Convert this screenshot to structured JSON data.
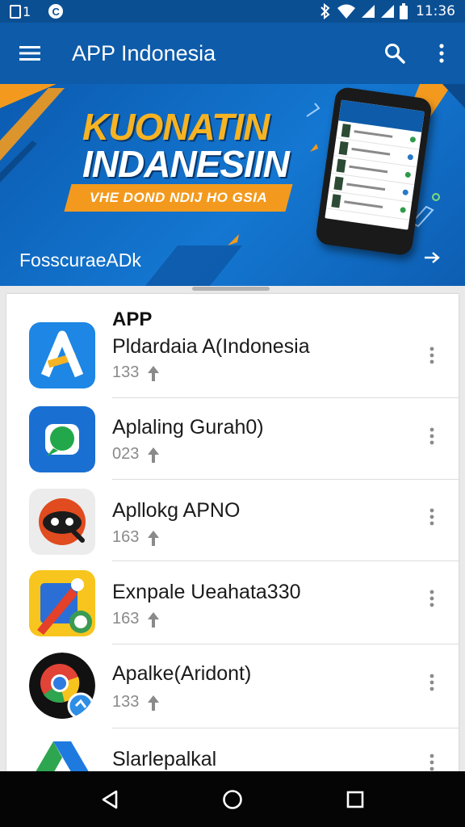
{
  "status_bar": {
    "notification_count": "1",
    "app_badge": "C",
    "icons": [
      "sim-icon",
      "c-notification-icon",
      "bluetooth-icon",
      "wifi-icon",
      "signal-icon",
      "signal-icon",
      "battery-icon"
    ],
    "time": "11:36"
  },
  "app_bar": {
    "title": "APP Indonesia",
    "icons": [
      "menu-icon",
      "search-icon",
      "more-vert-icon"
    ]
  },
  "banner": {
    "headline_line1": "KUONATIN",
    "headline_line2": "INDANESIIN",
    "ribbon_text": "VHE DOND NDIJ HO GSIA",
    "brand_text": "FosscuraeADk",
    "arrow_icon": "arrow-right-icon",
    "colors": {
      "accent_orange": "#f39a1e",
      "headline_yellow": "#f6b323",
      "banner_blue": "#1477d1"
    }
  },
  "list": {
    "section_header": "APP",
    "items": [
      {
        "name": "Pldardaia A(Indonesia",
        "meta": "133",
        "icon": "blue-a-app-icon"
      },
      {
        "name": "Aplaling Gurah0)",
        "meta": "023",
        "icon": "green-chat-app-icon"
      },
      {
        "name": "Apllokg APNO",
        "meta": "163",
        "icon": "red-dog-app-icon"
      },
      {
        "name": "Exnpale Ueahata330",
        "meta": "163",
        "icon": "yellow-edit-app-icon"
      },
      {
        "name": "Apalke(Aridont)",
        "meta": "133",
        "icon": "chrome-app-icon"
      },
      {
        "name": "Slarlepalkal",
        "meta": "",
        "icon": "drive-app-icon"
      }
    ],
    "item_meta_icon": "upload-arrow-icon"
  },
  "nav_bar": {
    "icons": [
      "back-icon",
      "home-icon",
      "recents-icon"
    ]
  }
}
